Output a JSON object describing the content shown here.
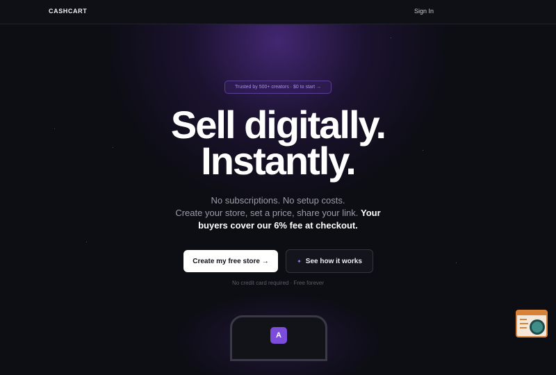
{
  "nav": {
    "logo": "CASHCART",
    "sign_in": "Sign In"
  },
  "hero": {
    "badge": "Trusted by 500+ creators · $0 to start →",
    "headline_line1": "Sell digitally.",
    "headline_line2": "Instantly.",
    "sub_line1": "No subscriptions. No setup costs.",
    "sub_line2_plain": "Create your store, set a price, share your link.",
    "sub_line2_bold": "Your",
    "sub_line3": "buyers cover our 6% fee at checkout.",
    "primary_cta": "Create my free store →",
    "secondary_cta": "See how it works",
    "secondary_icon": "sparkle-icon",
    "note": "No credit card required · Free forever"
  },
  "preview": {
    "app_icon_letter": "A"
  },
  "colors": {
    "background": "#0d0d14",
    "accent": "#7c4ddb",
    "badge_text": "#a98de6"
  }
}
